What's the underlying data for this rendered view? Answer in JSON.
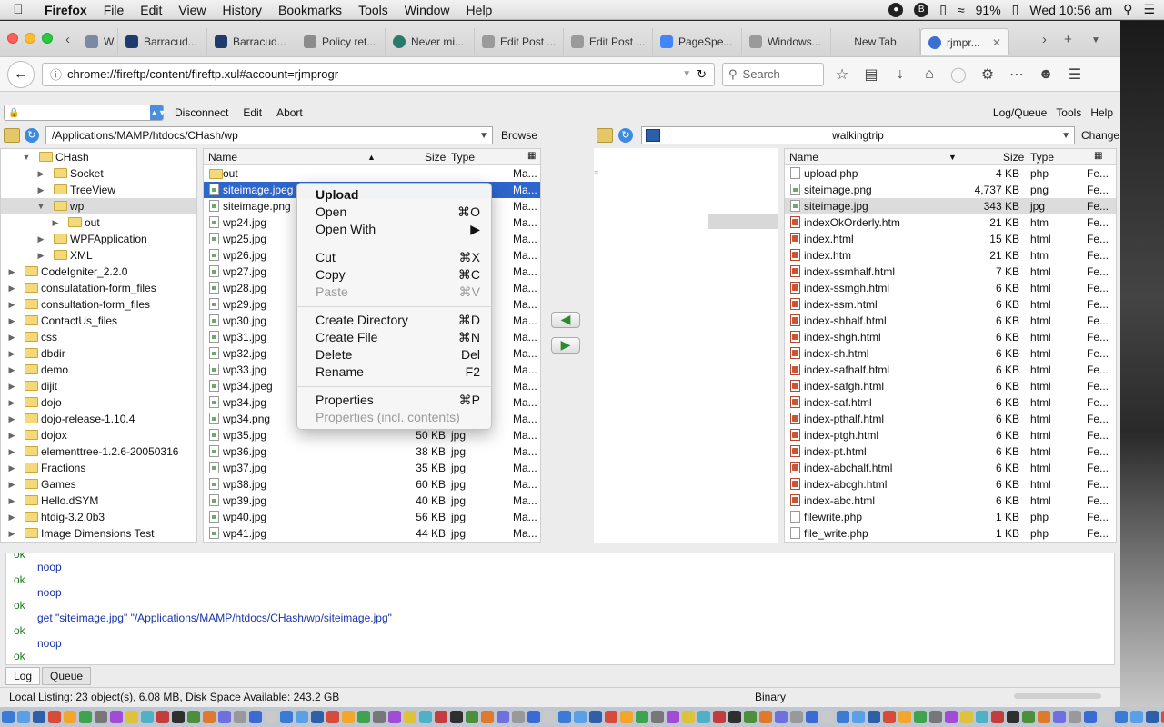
{
  "menubar": {
    "app": "Firefox",
    "items": [
      "File",
      "Edit",
      "View",
      "History",
      "Bookmarks",
      "Tools",
      "Window",
      "Help"
    ],
    "battery": "91%",
    "clock": "Wed 10:56 am"
  },
  "tabs": [
    {
      "label": "W..."
    },
    {
      "label": "Barracud..."
    },
    {
      "label": "Barracud..."
    },
    {
      "label": "Policy ret..."
    },
    {
      "label": "Never mi..."
    },
    {
      "label": "Edit Post ..."
    },
    {
      "label": "Edit Post ..."
    },
    {
      "label": "PageSpe..."
    },
    {
      "label": "Windows..."
    },
    {
      "label": "New Tab"
    },
    {
      "label": "rjmpr..."
    }
  ],
  "navbar": {
    "url": "chrome://fireftp/content/fireftp.xul#account=rjmprogr",
    "search_placeholder": "Search"
  },
  "ftp_toolbar": {
    "disconnect": "Disconnect",
    "edit": "Edit",
    "abort": "Abort",
    "log_queue": "Log/Queue",
    "tools": "Tools",
    "help": "Help"
  },
  "local": {
    "path": "/Applications/MAMP/htdocs/CHash/wp",
    "browse": "Browse",
    "tree": [
      {
        "label": "CHash",
        "level": 1,
        "open": true
      },
      {
        "label": "Socket",
        "level": 2
      },
      {
        "label": "TreeView",
        "level": 2
      },
      {
        "label": "wp",
        "level": 2,
        "open": true,
        "selected": true
      },
      {
        "label": "out",
        "level": 3
      },
      {
        "label": "WPFApplication",
        "level": 2
      },
      {
        "label": "XML",
        "level": 2
      },
      {
        "label": "CodeIgniter_2.2.0",
        "level": 0
      },
      {
        "label": "consulatation-form_files",
        "level": 0
      },
      {
        "label": "consultation-form_files",
        "level": 0
      },
      {
        "label": "ContactUs_files",
        "level": 0
      },
      {
        "label": "css",
        "level": 0
      },
      {
        "label": "dbdir",
        "level": 0
      },
      {
        "label": "demo",
        "level": 0
      },
      {
        "label": "dijit",
        "level": 0
      },
      {
        "label": "dojo",
        "level": 0
      },
      {
        "label": "dojo-release-1.10.4",
        "level": 0
      },
      {
        "label": "dojox",
        "level": 0
      },
      {
        "label": "elementtree-1.2.6-20050316",
        "level": 0
      },
      {
        "label": "Fractions",
        "level": 0
      },
      {
        "label": "Games",
        "level": 0
      },
      {
        "label": "Hello.dSYM",
        "level": 0
      },
      {
        "label": "htdig-3.2.0b3",
        "level": 0
      },
      {
        "label": "Image Dimensions Test",
        "level": 0
      }
    ],
    "columns": [
      "Name",
      "Size",
      "Type"
    ],
    "files": [
      {
        "name": "out",
        "size": "",
        "type": "",
        "date": "Ma...",
        "kind": "folder"
      },
      {
        "name": "siteimage.jpeg",
        "size": "",
        "type": "",
        "date": "Ma...",
        "kind": "img",
        "selected": true
      },
      {
        "name": "siteimage.png",
        "size": "",
        "type": "",
        "date": "Ma...",
        "kind": "img"
      },
      {
        "name": "wp24.jpg",
        "size": "",
        "type": "",
        "date": "Ma...",
        "kind": "img"
      },
      {
        "name": "wp25.jpg",
        "size": "",
        "type": "",
        "date": "Ma...",
        "kind": "img"
      },
      {
        "name": "wp26.jpg",
        "size": "",
        "type": "",
        "date": "Ma...",
        "kind": "img"
      },
      {
        "name": "wp27.jpg",
        "size": "",
        "type": "",
        "date": "Ma...",
        "kind": "img"
      },
      {
        "name": "wp28.jpg",
        "size": "",
        "type": "",
        "date": "Ma...",
        "kind": "img"
      },
      {
        "name": "wp29.jpg",
        "size": "",
        "type": "",
        "date": "Ma...",
        "kind": "img"
      },
      {
        "name": "wp30.jpg",
        "size": "",
        "type": "",
        "date": "Ma...",
        "kind": "img"
      },
      {
        "name": "wp31.jpg",
        "size": "",
        "type": "",
        "date": "Ma...",
        "kind": "img"
      },
      {
        "name": "wp32.jpg",
        "size": "",
        "type": "",
        "date": "Ma...",
        "kind": "img"
      },
      {
        "name": "wp33.jpg",
        "size": "",
        "type": "",
        "date": "Ma...",
        "kind": "img"
      },
      {
        "name": "wp34.jpeg",
        "size": "",
        "type": "",
        "date": "Ma...",
        "kind": "img"
      },
      {
        "name": "wp34.jpg",
        "size": "",
        "type": "",
        "date": "Ma...",
        "kind": "img"
      },
      {
        "name": "wp34.png",
        "size": "",
        "type": "",
        "date": "Ma...",
        "kind": "img"
      },
      {
        "name": "wp35.jpg",
        "size": "50 KB",
        "type": "jpg",
        "date": "Ma...",
        "kind": "img"
      },
      {
        "name": "wp36.jpg",
        "size": "38 KB",
        "type": "jpg",
        "date": "Ma...",
        "kind": "img"
      },
      {
        "name": "wp37.jpg",
        "size": "35 KB",
        "type": "jpg",
        "date": "Ma...",
        "kind": "img"
      },
      {
        "name": "wp38.jpg",
        "size": "60 KB",
        "type": "jpg",
        "date": "Ma...",
        "kind": "img"
      },
      {
        "name": "wp39.jpg",
        "size": "40 KB",
        "type": "jpg",
        "date": "Ma...",
        "kind": "img"
      },
      {
        "name": "wp40.jpg",
        "size": "56 KB",
        "type": "jpg",
        "date": "Ma...",
        "kind": "img"
      },
      {
        "name": "wp41.jpg",
        "size": "44 KB",
        "type": "jpg",
        "date": "Ma...",
        "kind": "img"
      }
    ]
  },
  "remote": {
    "path": "walkingtrip",
    "change": "Change",
    "columns": [
      "Name",
      "Size",
      "Type"
    ],
    "files": [
      {
        "name": "upload.php",
        "size": "4 KB",
        "type": "php",
        "date": "Fe...",
        "kind": "doc"
      },
      {
        "name": "siteimage.png",
        "size": "4,737 KB",
        "type": "png",
        "date": "Fe...",
        "kind": "img"
      },
      {
        "name": "siteimage.jpg",
        "size": "343 KB",
        "type": "jpg",
        "date": "Fe...",
        "kind": "img",
        "selected": true
      },
      {
        "name": "indexOkOrderly.htm",
        "size": "21 KB",
        "type": "htm",
        "date": "Fe...",
        "kind": "html"
      },
      {
        "name": "index.html",
        "size": "15 KB",
        "type": "html",
        "date": "Fe...",
        "kind": "html"
      },
      {
        "name": "index.htm",
        "size": "21 KB",
        "type": "htm",
        "date": "Fe...",
        "kind": "html"
      },
      {
        "name": "index-ssmhalf.html",
        "size": "7 KB",
        "type": "html",
        "date": "Fe...",
        "kind": "html"
      },
      {
        "name": "index-ssmgh.html",
        "size": "6 KB",
        "type": "html",
        "date": "Fe...",
        "kind": "html"
      },
      {
        "name": "index-ssm.html",
        "size": "6 KB",
        "type": "html",
        "date": "Fe...",
        "kind": "html"
      },
      {
        "name": "index-shhalf.html",
        "size": "6 KB",
        "type": "html",
        "date": "Fe...",
        "kind": "html"
      },
      {
        "name": "index-shgh.html",
        "size": "6 KB",
        "type": "html",
        "date": "Fe...",
        "kind": "html"
      },
      {
        "name": "index-sh.html",
        "size": "6 KB",
        "type": "html",
        "date": "Fe...",
        "kind": "html"
      },
      {
        "name": "index-safhalf.html",
        "size": "6 KB",
        "type": "html",
        "date": "Fe...",
        "kind": "html"
      },
      {
        "name": "index-safgh.html",
        "size": "6 KB",
        "type": "html",
        "date": "Fe...",
        "kind": "html"
      },
      {
        "name": "index-saf.html",
        "size": "6 KB",
        "type": "html",
        "date": "Fe...",
        "kind": "html"
      },
      {
        "name": "index-pthalf.html",
        "size": "6 KB",
        "type": "html",
        "date": "Fe...",
        "kind": "html"
      },
      {
        "name": "index-ptgh.html",
        "size": "6 KB",
        "type": "html",
        "date": "Fe...",
        "kind": "html"
      },
      {
        "name": "index-pt.html",
        "size": "6 KB",
        "type": "html",
        "date": "Fe...",
        "kind": "html"
      },
      {
        "name": "index-abchalf.html",
        "size": "6 KB",
        "type": "html",
        "date": "Fe...",
        "kind": "html"
      },
      {
        "name": "index-abcgh.html",
        "size": "6 KB",
        "type": "html",
        "date": "Fe...",
        "kind": "html"
      },
      {
        "name": "index-abc.html",
        "size": "6 KB",
        "type": "html",
        "date": "Fe...",
        "kind": "html"
      },
      {
        "name": "filewrite.php",
        "size": "1 KB",
        "type": "php",
        "date": "Fe...",
        "kind": "doc"
      },
      {
        "name": "file_write.php",
        "size": "1 KB",
        "type": "php",
        "date": "Fe...",
        "kind": "doc"
      }
    ]
  },
  "context_menu": [
    {
      "label": "Upload",
      "key": "",
      "bold": true
    },
    {
      "label": "Open",
      "key": "⌘O"
    },
    {
      "label": "Open With",
      "key": "▶"
    },
    {
      "sep": true
    },
    {
      "label": "Cut",
      "key": "⌘X"
    },
    {
      "label": "Copy",
      "key": "⌘C"
    },
    {
      "label": "Paste",
      "key": "⌘V",
      "disabled": true
    },
    {
      "sep": true
    },
    {
      "label": "Create Directory",
      "key": "⌘D"
    },
    {
      "label": "Create File",
      "key": "⌘N"
    },
    {
      "label": "Delete",
      "key": "Del"
    },
    {
      "label": "Rename",
      "key": "F2"
    },
    {
      "sep": true
    },
    {
      "label": "Properties",
      "key": "⌘P"
    },
    {
      "label": "Properties (incl. contents)",
      "key": "",
      "disabled": true
    }
  ],
  "log": [
    {
      "kind": "ok",
      "text": "ok"
    },
    {
      "kind": "cmd",
      "text": "noop"
    },
    {
      "kind": "ok",
      "text": "ok"
    },
    {
      "kind": "cmd",
      "text": "noop"
    },
    {
      "kind": "ok",
      "text": "ok"
    },
    {
      "kind": "cmd",
      "text": "get \"siteimage.jpg\" \"/Applications/MAMP/htdocs/CHash/wp/siteimage.jpg\""
    },
    {
      "kind": "ok",
      "text": "ok"
    },
    {
      "kind": "cmd",
      "text": "noop"
    },
    {
      "kind": "ok",
      "text": "ok"
    }
  ],
  "log_tabs": [
    "Log",
    "Queue"
  ],
  "status": {
    "left": "Local Listing: 23 object(s), 6.08 MB, Disk Space Available: 243.2 GB",
    "mode": "Binary"
  },
  "colors": {
    "selection_blue": "#2f66cc",
    "log_cmd": "#1a33aa",
    "log_ok": "#1a7a1a"
  }
}
